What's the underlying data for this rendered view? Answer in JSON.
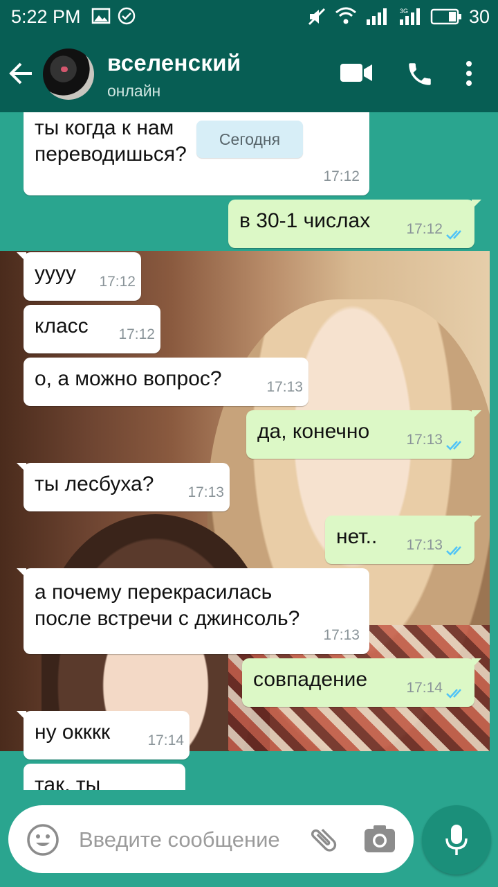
{
  "status_bar": {
    "time": "5:22 PM",
    "battery": "30"
  },
  "header": {
    "contact_name": "вселенский",
    "contact_status": "онлайн"
  },
  "chat": {
    "date_chip": "Сегодня",
    "messages": [
      {
        "direction": "in",
        "text": "ты когда к нам\nпереводишься?",
        "time": "17:12"
      },
      {
        "direction": "out",
        "text": "в 30-1 числах",
        "time": "17:12",
        "read": true
      },
      {
        "direction": "in",
        "text": "уууу",
        "time": "17:12"
      },
      {
        "direction": "in",
        "text": "класс",
        "time": "17:12"
      },
      {
        "direction": "in",
        "text": "о, а можно вопрос?",
        "time": "17:13"
      },
      {
        "direction": "out",
        "text": "да, конечно",
        "time": "17:13",
        "read": true
      },
      {
        "direction": "in",
        "text": "ты лесбуха?",
        "time": "17:13"
      },
      {
        "direction": "out",
        "text": "нет..",
        "time": "17:13",
        "read": true
      },
      {
        "direction": "in",
        "text": "а почему перекрасилась\nпосле встречи с джинсоль?",
        "time": "17:13"
      },
      {
        "direction": "out",
        "text": "совпадение",
        "time": "17:14",
        "read": true
      },
      {
        "direction": "in",
        "text": "ну окккк",
        "time": "17:14"
      },
      {
        "direction": "in",
        "text": "так, ты",
        "time": ""
      }
    ]
  },
  "input": {
    "placeholder": "Введите сообщение"
  },
  "colors": {
    "header": "#075e54",
    "outgoing_bubble": "#dcf8c6",
    "incoming_bubble": "#ffffff",
    "read_ticks": "#4fc3f7",
    "mic_button": "#1b8f7a"
  }
}
